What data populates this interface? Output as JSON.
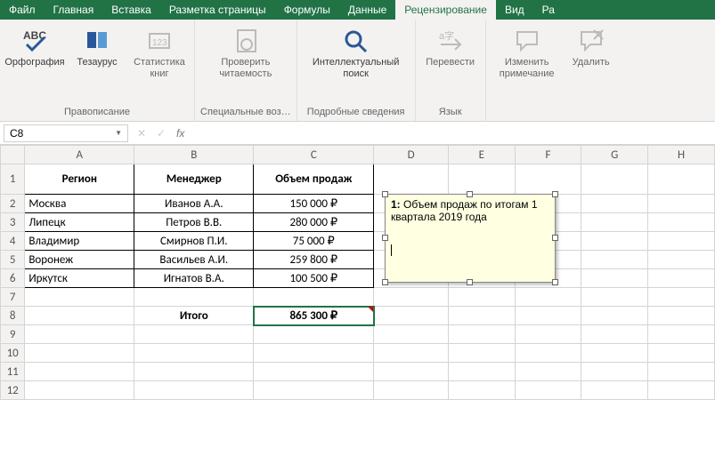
{
  "tabs": {
    "file": "Файл",
    "home": "Главная",
    "insert": "Вставка",
    "layout": "Разметка страницы",
    "formulas": "Формулы",
    "data": "Данные",
    "review": "Рецензирование",
    "view": "Вид",
    "more": "Ра"
  },
  "ribbon": {
    "spellcheck": "Орфография",
    "thesaurus": "Тезаурус",
    "bookstats": "Статистика книг",
    "readability": "Проверить читаемость",
    "smartlook": "Интеллектуальный поиск",
    "translate": "Перевести",
    "editcomment": "Изменить примечание",
    "deletecomment": "Удалить",
    "abc": "ABC",
    "g_spelling": "Правописание",
    "g_special": "Специальные воз…",
    "g_details": "Подробные сведения",
    "g_lang": "Язык"
  },
  "namebox": "C8",
  "fx": "fx",
  "cols": [
    "A",
    "B",
    "C",
    "D",
    "E",
    "F",
    "G",
    "H"
  ],
  "rows": [
    "1",
    "2",
    "3",
    "4",
    "5",
    "6",
    "7",
    "8",
    "9",
    "10",
    "11",
    "12"
  ],
  "headers": {
    "a": "Регион",
    "b": "Менеджер",
    "c": "Объем продаж"
  },
  "data": [
    {
      "a": "Москва",
      "b": "Иванов А.А.",
      "c": "150 000 ₽"
    },
    {
      "a": "Липецк",
      "b": "Петров В.В.",
      "c": "280 000 ₽"
    },
    {
      "a": "Владимир",
      "b": "Смирнов П.И.",
      "c": "75 000 ₽"
    },
    {
      "a": "Воронеж",
      "b": "Васильев А.И.",
      "c": "259 800 ₽"
    },
    {
      "a": "Иркутск",
      "b": "Игнатов В.А.",
      "c": "100 500 ₽"
    }
  ],
  "total": {
    "label": "Итого",
    "value": "865 300 ₽"
  },
  "comment": {
    "author": "1:",
    "text": "Объем продаж по итогам 1 квартала 2019 года"
  }
}
